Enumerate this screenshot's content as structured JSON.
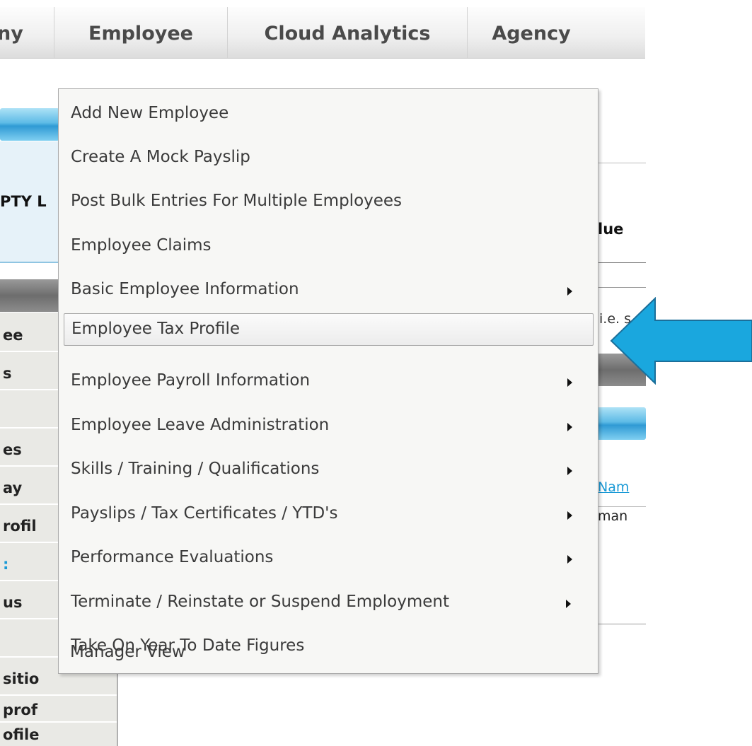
{
  "nav": {
    "tabs": [
      {
        "label": "ny"
      },
      {
        "label": "Employee"
      },
      {
        "label": "Cloud Analytics"
      },
      {
        "label": "Agency"
      }
    ]
  },
  "background": {
    "company_fragment": "PTY L",
    "column_fragment": "lue",
    "hint_fragment": "i.e. s",
    "link_fragment": "Nam",
    "value_fragment": "man",
    "left_rows": [
      "ee",
      "s",
      "",
      "es",
      "ay",
      "rofil",
      ":",
      "us",
      "",
      "sitio",
      "prof",
      "ofile"
    ]
  },
  "menu": {
    "items": [
      {
        "label": "Add New Employee",
        "has_submenu": false
      },
      {
        "label": "Create A Mock Payslip",
        "has_submenu": false
      },
      {
        "label": "Post Bulk Entries For Multiple Employees",
        "has_submenu": false
      },
      {
        "label": "Employee Claims",
        "has_submenu": false
      },
      {
        "label": "Basic Employee Information",
        "has_submenu": true
      },
      {
        "label": "Employee Tax Profile",
        "has_submenu": false,
        "highlighted": true
      },
      {
        "label": "Employee Payroll Information",
        "has_submenu": true
      },
      {
        "label": "Employee Leave Administration",
        "has_submenu": true
      },
      {
        "label": "Skills / Training / Qualifications",
        "has_submenu": true
      },
      {
        "label": "Payslips / Tax Certificates / YTD's",
        "has_submenu": true
      },
      {
        "label": "Performance Evaluations",
        "has_submenu": true
      },
      {
        "label": "Terminate / Reinstate or Suspend Employment",
        "has_submenu": true
      },
      {
        "label": "Take On Year To Date Figures",
        "has_submenu": false
      },
      {
        "label": "Manager View",
        "has_submenu": false
      }
    ]
  },
  "colors": {
    "callout_arrow": "#1aa7de",
    "menu_background": "#f7f7f5",
    "nav_text": "#4a4a4a",
    "link": "#1a9ad6"
  }
}
